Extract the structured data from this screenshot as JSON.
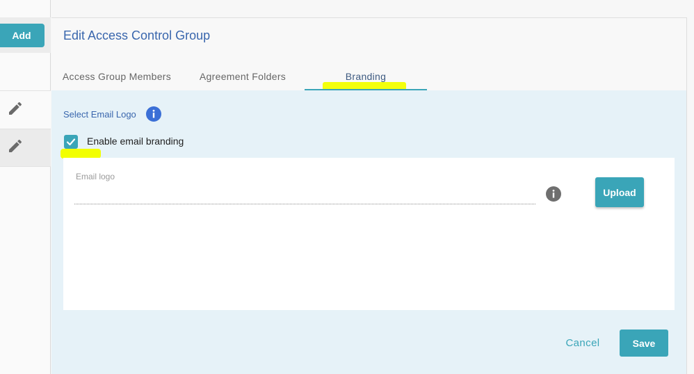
{
  "sidebar": {
    "add_label": "Add",
    "rows": [
      {
        "icon": "pencil-icon"
      },
      {
        "icon": "pencil-icon"
      }
    ]
  },
  "dialog": {
    "title": "Edit Access Control Group",
    "tabs": [
      {
        "label": "Access Group Members",
        "active": false
      },
      {
        "label": "Agreement Folders",
        "active": false
      },
      {
        "label": "Branding",
        "active": true
      }
    ],
    "section_label": "Select Email Logo",
    "section_icon": "info-icon",
    "checkbox": {
      "label": "Enable email branding",
      "checked": true
    },
    "email_logo": {
      "label": "Email logo",
      "value": ""
    },
    "upload_label": "Upload",
    "cancel_label": "Cancel",
    "save_label": "Save"
  },
  "colors": {
    "accent": "#3aa5b8",
    "title": "#3966ad",
    "panel_bg": "#e6f2f8",
    "highlight": "#f2ff00",
    "info_blue": "#3b6fd6"
  }
}
